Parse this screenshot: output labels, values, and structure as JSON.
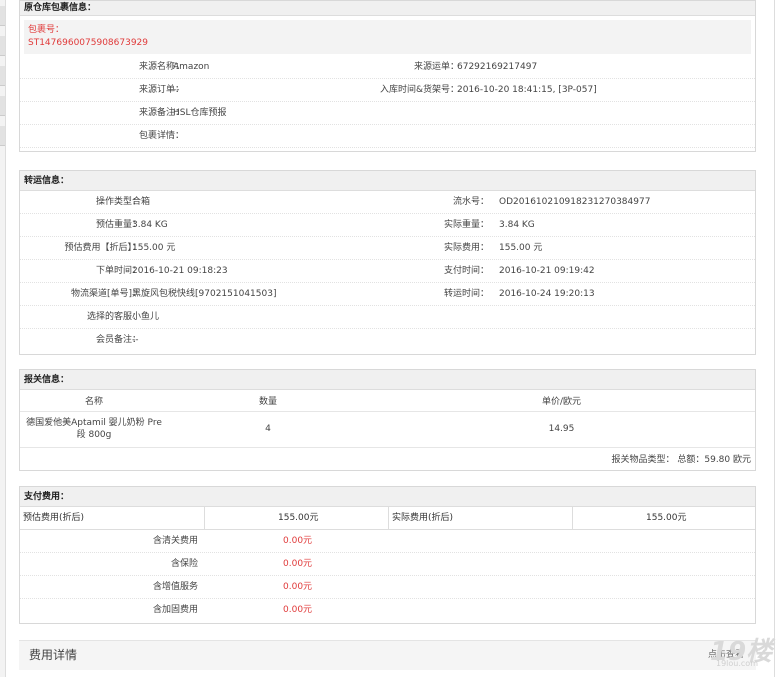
{
  "origin": {
    "title": "原仓库包裹信息：",
    "package_label": "包裹号：",
    "package_no": "ST1476960075908673929",
    "rows": [
      {
        "l1": "来源名称：",
        "v1": "Amazon",
        "l2": "来源运单：",
        "v2": "67292169217497"
      },
      {
        "l1": "来源订单：",
        "v1": "--",
        "l2": "入库时间&货架号：",
        "v2": "2016-10-20 18:41:15, [3P-057]"
      },
      {
        "l1": "来源备注：",
        "v1": "HSL仓库预报",
        "l2": "",
        "v2": ""
      },
      {
        "l1": "包裹详情：",
        "v1": "",
        "l2": "",
        "v2": ""
      }
    ]
  },
  "transfer": {
    "title": "转运信息：",
    "rows": [
      {
        "l1": "操作类型：",
        "v1": "合箱",
        "l2": "流水号：",
        "v2": "OD20161021091823127038​4977"
      },
      {
        "l1": "预估重量：",
        "v1": "3.84 KG",
        "l2": "实际重量：",
        "v2": "3.84 KG"
      },
      {
        "l1": "预估费用【折后】：",
        "v1": "155.00 元",
        "l2": "实际费用：",
        "v2": "155.00 元"
      },
      {
        "l1": "下单时间：",
        "v1": "2016-10-21 09:18:23",
        "l2": "支付时间：",
        "v2": "2016-10-21 09:19:42"
      },
      {
        "l1": "物流渠道[单号]：",
        "v1": "黑旋风包税快线[9702151041503]",
        "l2": "转运时间：",
        "v2": "2016-10-24 19:20:13"
      },
      {
        "l1": "选择的客服：",
        "v1": "小鱼儿",
        "l2": "",
        "v2": ""
      },
      {
        "l1": "会员备注：",
        "v1": "--",
        "l2": "",
        "v2": ""
      }
    ]
  },
  "customs": {
    "title": "报关信息：",
    "headers": [
      "名称",
      "数量",
      "单价/欧元"
    ],
    "item_name_1": "德国爱他美Aptamil 婴儿奶粉 Pre",
    "item_name_2": "段 800g",
    "item_qty": "4",
    "item_price": "14.95",
    "summary": "报关物品类型： 总额：59.80 欧元"
  },
  "payment": {
    "title": "支付费用：",
    "est_label": "预估费用(折后)",
    "est_value": "155.00元",
    "actual_label": "实际费用(折后)",
    "actual_value": "155.00元",
    "fees": [
      {
        "label": "含清关费用",
        "value": "0.00元"
      },
      {
        "label": "含保险",
        "value": "0.00元"
      },
      {
        "label": "含增值服务",
        "value": "0.00元"
      },
      {
        "label": "含加固费用",
        "value": "0.00元"
      }
    ]
  },
  "fee_detail": {
    "title": "费用详情",
    "right": "点击查看"
  },
  "watermark": {
    "big": "19楼",
    "small": "19lou.com"
  }
}
